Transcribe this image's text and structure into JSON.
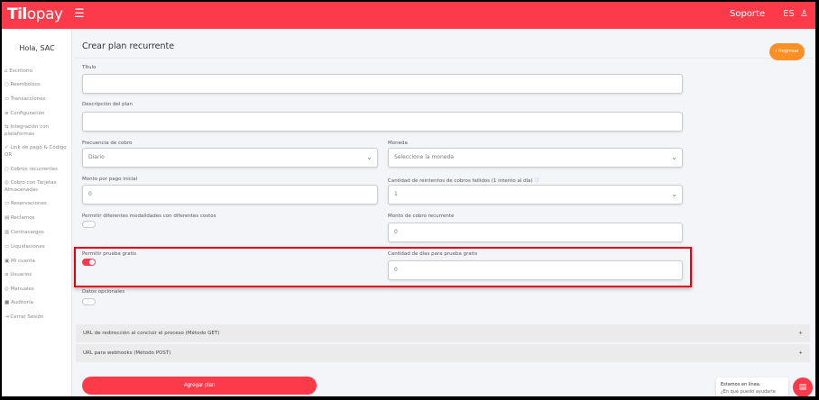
{
  "header": {
    "logo": "Tilopay",
    "support": "Soporte",
    "lang": "ES"
  },
  "sidebar": {
    "greeting": "Hola, SAC",
    "items": [
      {
        "icon": "⌂",
        "label": "Escritorio"
      },
      {
        "icon": "○",
        "label": "Reembolsos"
      },
      {
        "icon": "▭",
        "label": "Transacciones"
      },
      {
        "icon": "≡",
        "label": "Configuración"
      },
      {
        "icon": "⇆",
        "label": "Integración con plataformas"
      },
      {
        "icon": "✓",
        "label": "Link de pago & Código QR"
      },
      {
        "icon": "○",
        "label": "Cobros recurrentes"
      },
      {
        "icon": "◎",
        "label": "Cobro con Tarjetas Almacenadas"
      },
      {
        "icon": "▭",
        "label": "Reservaciones"
      },
      {
        "icon": "▤",
        "label": "Reclamos"
      },
      {
        "icon": "▥",
        "label": "Contracargos"
      },
      {
        "icon": "▭",
        "label": "Liquidaciones"
      },
      {
        "icon": "▣",
        "label": "Mi cuenta"
      },
      {
        "icon": "≡",
        "label": "Usuarios"
      },
      {
        "icon": "◎",
        "label": "Manuales"
      },
      {
        "icon": "■",
        "label": "Auditoría"
      },
      {
        "icon": "⇥",
        "label": "Cerrar Sesión"
      }
    ]
  },
  "page": {
    "title": "Crear plan recurrente",
    "back": "‹ Regresar"
  },
  "form": {
    "titulo_label": "Título",
    "titulo_value": "",
    "desc_label": "Descripción del plan",
    "desc_value": "",
    "freq_label": "Frecuencia de cobro",
    "freq_value": "Diario",
    "moneda_label": "Moneda",
    "moneda_value": "Seleccione la moneda",
    "monto_inicial_label": "Monto por pago inicial",
    "monto_inicial_value": "0",
    "reintentos_label": "Cantidad de reintentos de cobros fallidos (1 intento al día)",
    "reintentos_value": "1",
    "modalidades_label": "Permitir diferentes modalidades con diferentes costos",
    "modalidades_on": false,
    "monto_recurrente_label": "Monto de cobro recurrente",
    "monto_recurrente_value": "0",
    "prueba_label": "Permitir prueba gratis",
    "prueba_on": true,
    "dias_prueba_label": "Cantidad de días para prueba gratis",
    "dias_prueba_value": "0",
    "opcionales_label": "Datos opcionales",
    "opcionales_on": false
  },
  "accordions": [
    {
      "label": "URL de redirección al concluir el proceso (Método GET)"
    },
    {
      "label": "URL para webhooks (Método POST)"
    }
  ],
  "submit": "Agregar plan",
  "chat": {
    "line1": "Estamos en línea.",
    "line2": "¿En qué puedo ayudarle hoy?"
  }
}
